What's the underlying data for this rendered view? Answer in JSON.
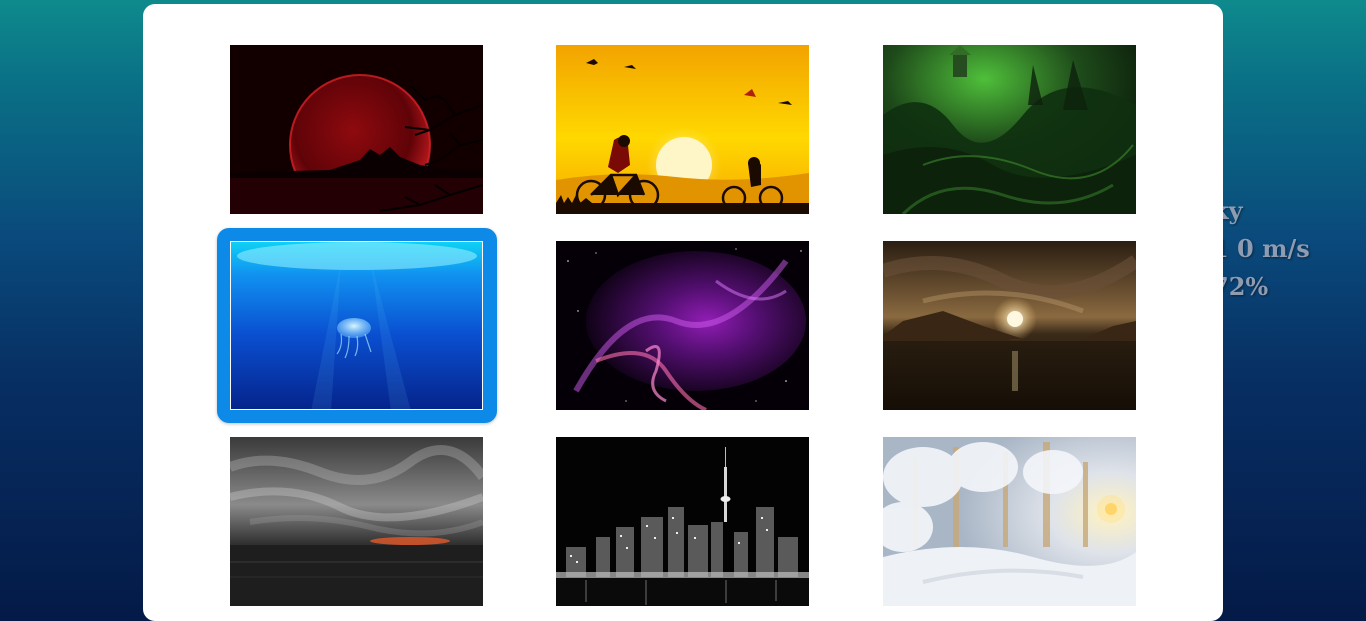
{
  "background_weather": {
    "line1": "ky",
    "line2": "1 0 m/s",
    "line3": "72%"
  },
  "wallpaper_picker": {
    "selected_index": 3,
    "thumbnails": [
      {
        "name": "red-moon-silhouette"
      },
      {
        "name": "cyclists-sunset"
      },
      {
        "name": "green-fantasy-landscape"
      },
      {
        "name": "jellyfish-underwater"
      },
      {
        "name": "purple-nebula"
      },
      {
        "name": "moonlit-lake"
      },
      {
        "name": "stormy-sea-clouds"
      },
      {
        "name": "city-skyline-night"
      },
      {
        "name": "snowy-forest-sunrise"
      }
    ]
  },
  "colors": {
    "selection_accent": "#0d8ae8",
    "modal_background": "#ffffff"
  }
}
